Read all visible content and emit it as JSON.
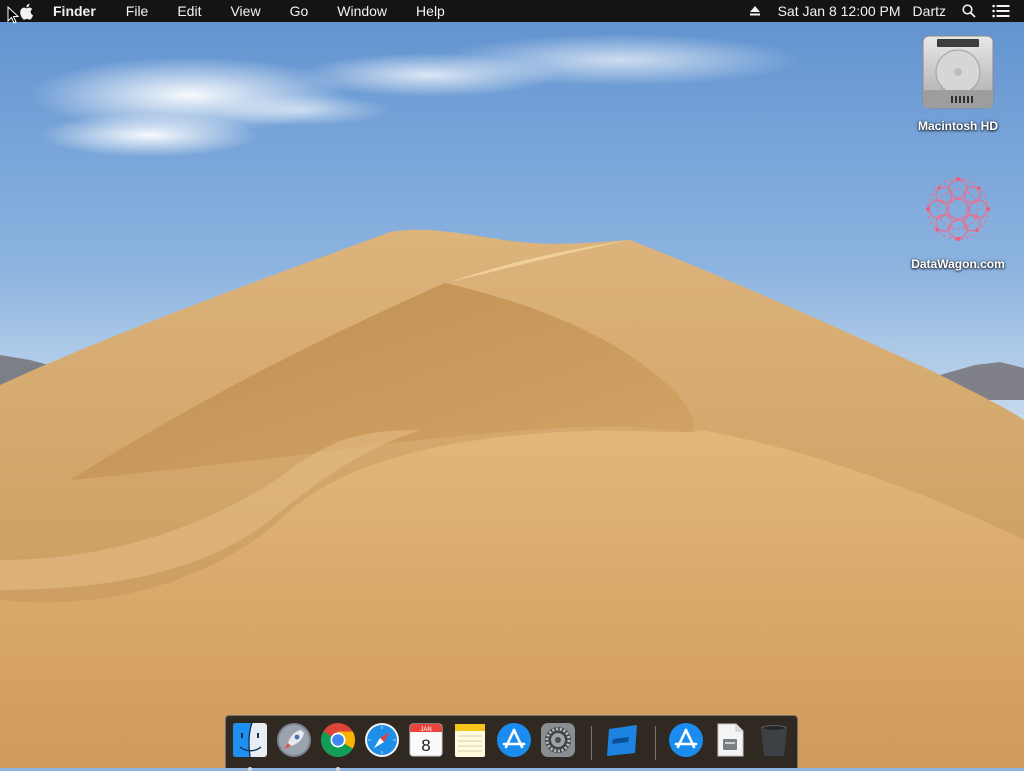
{
  "menubar": {
    "app_name": "Finder",
    "menus": [
      "File",
      "Edit",
      "View",
      "Go",
      "Window",
      "Help"
    ],
    "clock": "Sat Jan 8  12:00 PM",
    "user": "Dartz",
    "icons": [
      "apple-logo-icon",
      "eject-icon",
      "spotlight-search-icon",
      "notification-center-icon"
    ]
  },
  "desktop": {
    "icons": [
      {
        "label": "Macintosh HD",
        "icon": "hard-drive-icon"
      },
      {
        "label": "DataWagon.com",
        "icon": "datawagon-pattern-icon"
      }
    ]
  },
  "dock": {
    "apps": [
      {
        "name": "Finder",
        "icon": "finder-icon",
        "running": true
      },
      {
        "name": "Launchpad",
        "icon": "launchpad-rocket-icon",
        "running": false
      },
      {
        "name": "Google Chrome",
        "icon": "chrome-icon",
        "running": true
      },
      {
        "name": "Safari",
        "icon": "safari-compass-icon",
        "running": false
      },
      {
        "name": "Calendar",
        "icon": "calendar-icon",
        "running": false,
        "month": "JAN",
        "day": "8"
      },
      {
        "name": "Notes",
        "icon": "notes-icon",
        "running": false
      },
      {
        "name": "App Store",
        "icon": "app-store-icon",
        "running": false
      },
      {
        "name": "System Preferences",
        "icon": "gear-icon",
        "running": false
      },
      {
        "name": "Blue App",
        "icon": "blue-square-icon",
        "running": false
      },
      {
        "name": "App Store Download",
        "icon": "app-store-icon",
        "running": false
      },
      {
        "name": "Document",
        "icon": "document-icon",
        "running": false
      },
      {
        "name": "Trash",
        "icon": "trash-icon",
        "running": false
      }
    ]
  },
  "colors": {
    "menubar_bg": "#141414",
    "sky_top": "#5f91cf",
    "sand": "#d9a968"
  }
}
